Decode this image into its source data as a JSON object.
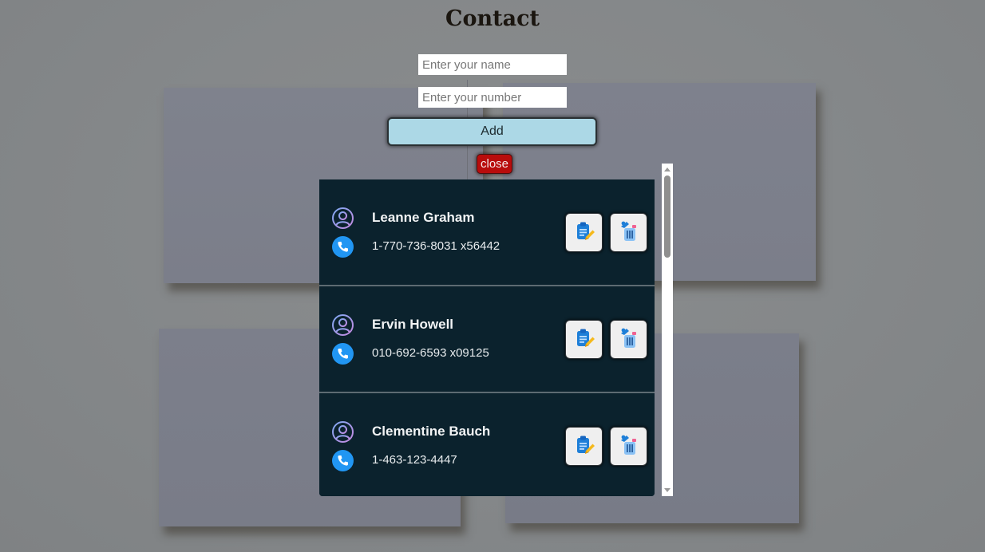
{
  "page": {
    "title": "Contact"
  },
  "form": {
    "name_placeholder": "Enter your name",
    "name_value": "",
    "number_placeholder": "Enter your number",
    "number_value": "",
    "add_label": "Add",
    "close_label": "close"
  },
  "contacts": [
    {
      "name": "Leanne Graham",
      "phone": "1-770-736-8031 x56442",
      "user_icon": "user-circle-icon",
      "phone_icon": "phone-icon",
      "edit_icon": "clipboard-edit-icon",
      "delete_icon": "trash-icon"
    },
    {
      "name": "Ervin Howell",
      "phone": "010-692-6593 x09125",
      "user_icon": "user-circle-icon",
      "phone_icon": "phone-icon",
      "edit_icon": "clipboard-edit-icon",
      "delete_icon": "trash-icon"
    },
    {
      "name": "Clementine Bauch",
      "phone": "1-463-123-4447",
      "user_icon": "user-circle-icon",
      "phone_icon": "phone-icon",
      "edit_icon": "clipboard-edit-icon",
      "delete_icon": "trash-icon"
    }
  ],
  "colors": {
    "list_bg": "#0b222d",
    "add_button": "#acd8e6",
    "close_button": "#b80c0c",
    "phone_icon": "#2196f3",
    "user_icon_gradient": [
      "#7ea8f0",
      "#c58ae0"
    ]
  }
}
